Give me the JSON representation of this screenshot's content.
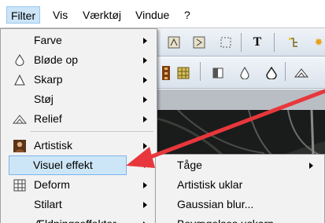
{
  "menubar": {
    "items": [
      {
        "label": "Filter",
        "active": true
      },
      {
        "label": "Vis",
        "active": false
      },
      {
        "label": "Værktøj",
        "active": false
      },
      {
        "label": "Vindue",
        "active": false
      },
      {
        "label": "?",
        "active": false
      }
    ]
  },
  "toolbar": {
    "row1_icons": [
      "import-icon",
      "export-icon",
      "selection-icon",
      "text-tool-icon",
      "tree-icon",
      "star-icon"
    ],
    "row2_icons": [
      "film-icon",
      "grid-icon",
      "contrast-icon",
      "drop-icon",
      "drop-outline-icon",
      "relief-icon"
    ]
  },
  "filter_menu": {
    "items": [
      {
        "label": "Farve",
        "icon": "",
        "submenu": true
      },
      {
        "label": "Bløde op",
        "icon": "soften-drop-icon",
        "submenu": true
      },
      {
        "label": "Skarp",
        "icon": "sharpen-triangle-icon",
        "submenu": true
      },
      {
        "label": "Støj",
        "icon": "",
        "submenu": true
      },
      {
        "label": "Relief",
        "icon": "relief-icon",
        "submenu": true
      },
      {
        "label": "Artistisk",
        "icon": "portrait-icon",
        "submenu": true
      },
      {
        "label": "Visuel effekt",
        "icon": "",
        "submenu": true,
        "highlighted": true
      },
      {
        "label": "Deform",
        "icon": "grid-deform-icon",
        "submenu": true
      },
      {
        "label": "Stilart",
        "icon": "",
        "submenu": true
      },
      {
        "label": "Ældningseffekter",
        "icon": "",
        "submenu": true
      }
    ]
  },
  "visual_effect_submenu": {
    "items": [
      {
        "label": "Tåge",
        "submenu": true
      },
      {
        "label": "Artistisk uklar",
        "submenu": false
      },
      {
        "label": "Gaussian blur...",
        "submenu": false
      },
      {
        "label": "Bevægelses uskarp",
        "submenu": false
      }
    ]
  },
  "colors": {
    "menu_bg": "#f2f2f2",
    "highlight_bg": "#cde6f7",
    "annotation_arrow": "#e8373c"
  }
}
